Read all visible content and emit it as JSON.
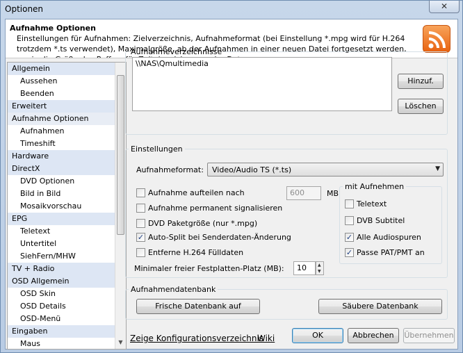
{
  "window": {
    "title": "Optionen",
    "close_symbol": "✕"
  },
  "header": {
    "title": "Aufnahme Optionen",
    "description": "Einstellungen für Aufnahmen: Zielverzeichnis, Aufnahmeformat (bei Einstellung *.mpg wird für H.264 trotzdem *.ts verwendet), Maximalgröße, ab der Aufnahmen in einer neuen Datei fortgesetzt werden, sowie die Größe des Puffers für Zeitabweichungen der Daten."
  },
  "nav": {
    "items": [
      {
        "label": "Allgemein"
      },
      {
        "label": "Aussehen"
      },
      {
        "label": "Beenden"
      },
      {
        "label": "Erweitert"
      },
      {
        "label": "Aufnahme Optionen"
      },
      {
        "label": "Aufnahmen"
      },
      {
        "label": "Timeshift"
      },
      {
        "label": "Hardware"
      },
      {
        "label": "DirectX"
      },
      {
        "label": "DVD Optionen"
      },
      {
        "label": "Bild in Bild"
      },
      {
        "label": "Mosaikvorschau"
      },
      {
        "label": "EPG"
      },
      {
        "label": "Teletext"
      },
      {
        "label": "Untertitel"
      },
      {
        "label": "SiehFern/MHW"
      },
      {
        "label": "TV + Radio"
      },
      {
        "label": "OSD Allgemein"
      },
      {
        "label": "OSD Skin"
      },
      {
        "label": "OSD Details"
      },
      {
        "label": "OSD-Menü"
      },
      {
        "label": "Eingaben"
      },
      {
        "label": "Maus"
      }
    ]
  },
  "directories": {
    "legend": "Aufnahmeverzeichnisse",
    "items": [
      "\\\\NAS\\Qmultimedia"
    ],
    "add_label": "Hinzuf.",
    "delete_label": "Löschen"
  },
  "settings": {
    "legend": "Einstellungen",
    "format_label": "Aufnahmeformat:",
    "format_value": "Video/Audio TS (*.ts)",
    "split_label": "Aufnahme aufteilen nach",
    "split_size": "600",
    "split_unit": "MB",
    "permanent_label": "Aufnahme permanent signalisieren",
    "dvd_label": "DVD Paketgröße (nur *.mpg)",
    "autosplit_label": "Auto-Split bei Senderdaten-Änderung",
    "h264_label": "Entferne H.264 Fülldaten",
    "min_space_label": "Minimaler freier Festplatten-Platz (MB):",
    "min_space_value": "10",
    "check_symbol": "✓"
  },
  "with_recording": {
    "legend": "mit Aufnehmen",
    "teletext_label": "Teletext",
    "dvb_subtitle_label": "DVB Subtitel",
    "all_audio_label": "Alle Audiospuren",
    "pat_pmt_label": "Passe PAT/PMT an"
  },
  "database": {
    "legend": "Aufnahmendatenbank",
    "fresh_label": "Frische Datenbank auf",
    "clean_label": "Säubere Datenbank"
  },
  "footer": {
    "config_link": "Zeige Konfigurationsverzeichnis",
    "wiki_link": "Wiki",
    "ok_label": "OK",
    "cancel_label": "Abbrechen",
    "apply_label": "Übernehmen"
  }
}
